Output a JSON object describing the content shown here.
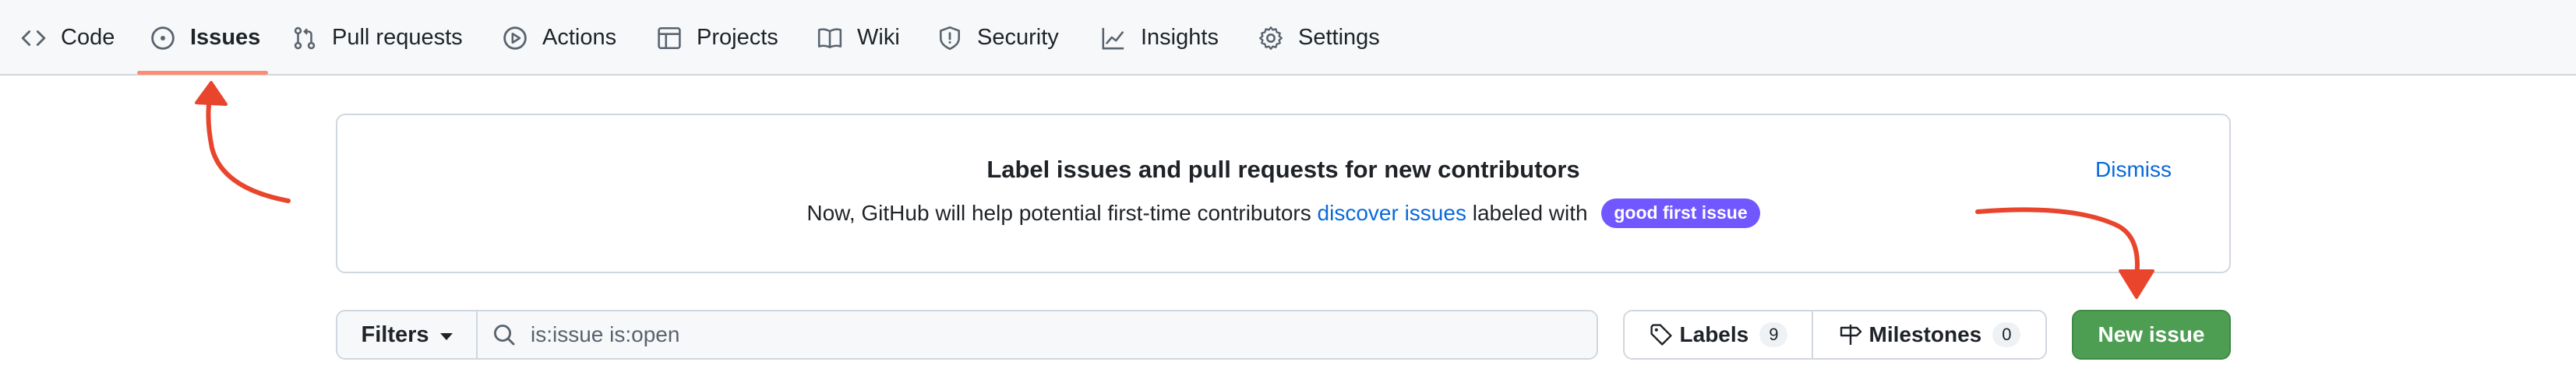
{
  "nav": {
    "tabs": [
      {
        "label": "Code",
        "icon": "code-icon"
      },
      {
        "label": "Issues",
        "icon": "issue-opened-icon",
        "active": true
      },
      {
        "label": "Pull requests",
        "icon": "git-pull-request-icon"
      },
      {
        "label": "Actions",
        "icon": "play-icon"
      },
      {
        "label": "Projects",
        "icon": "table-icon"
      },
      {
        "label": "Wiki",
        "icon": "book-icon"
      },
      {
        "label": "Security",
        "icon": "shield-icon"
      },
      {
        "label": "Insights",
        "icon": "graph-icon"
      },
      {
        "label": "Settings",
        "icon": "gear-icon"
      }
    ]
  },
  "banner": {
    "title": "Label issues and pull requests for new contributors",
    "text_before": "Now, GitHub will help potential first-time contributors ",
    "link_text": "discover issues",
    "text_after": " labeled with ",
    "label_pill": "good first issue",
    "dismiss": "Dismiss"
  },
  "toolbar": {
    "filters_label": "Filters",
    "search_value": "is:issue is:open",
    "labels_label": "Labels",
    "labels_count": "9",
    "milestones_label": "Milestones",
    "milestones_count": "0",
    "new_issue_label": "New issue"
  },
  "colors": {
    "accent_link": "#0969da",
    "active_tab_underline": "#fd8c73",
    "label_pill": "#7057ff",
    "primary_button": "#4d9e53",
    "annotation_arrow": "#e8452c"
  }
}
